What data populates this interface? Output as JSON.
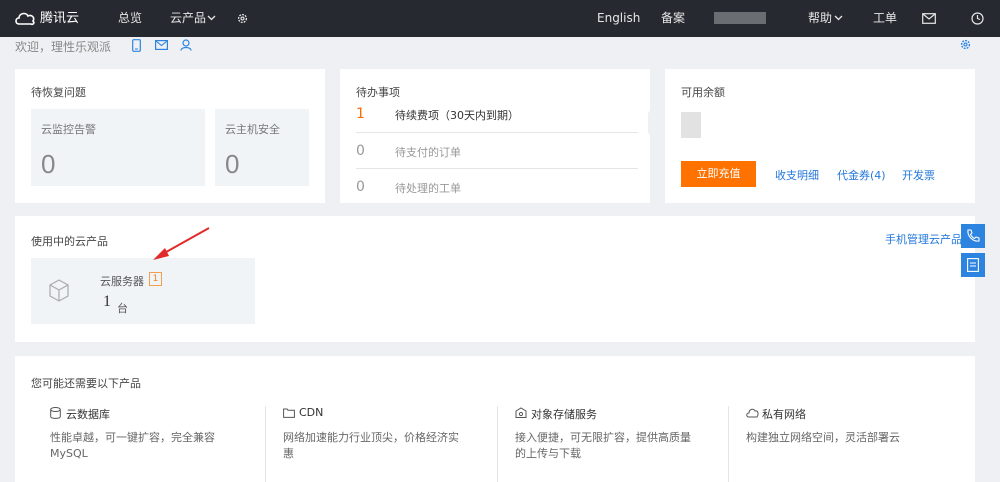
{
  "topbar": {
    "logo_text": "腾讯云",
    "nav_overview": "总览",
    "nav_products": "云产品",
    "lang": "English",
    "beian": "备案",
    "help": "帮助",
    "ticket": "工单"
  },
  "welcome": {
    "text": "欢迎，理性乐观派"
  },
  "recovery": {
    "title": "待恢复问题",
    "items": [
      {
        "label": "云监控告警",
        "value": "0"
      },
      {
        "label": "云主机安全",
        "value": "0"
      }
    ]
  },
  "todo": {
    "title": "待办事项",
    "items": [
      {
        "count": "1",
        "label": "待续费项（30天内到期）"
      },
      {
        "count": "0",
        "label": "待支付的订单"
      },
      {
        "count": "0",
        "label": "待处理的工单"
      }
    ]
  },
  "balance": {
    "title": "可用余额",
    "recharge_label": "立即充值",
    "links": [
      "收支明细",
      "代金券(4)",
      "开发票"
    ]
  },
  "inuse": {
    "title": "使用中的云产品",
    "mobile_link": "手机管理云产品",
    "product": {
      "name": "云服务器",
      "badge": "1",
      "count": "1",
      "unit": "台"
    }
  },
  "suggest": {
    "title": "您可能还需要以下产品",
    "items": [
      {
        "name": "云数据库",
        "desc": "性能卓越，可一键扩容，完全兼容MySQL"
      },
      {
        "name": "CDN",
        "desc": "网络加速能力行业顶尖，价格经济实惠"
      },
      {
        "name": "对象存储服务",
        "desc": "接入便捷，可无限扩容，提供高质量的上传与下载"
      },
      {
        "name": "私有网络",
        "desc": "构建独立网络空间，灵活部署云"
      }
    ]
  },
  "colors": {
    "topbar": "#262a30",
    "accent_orange": "#ff7200",
    "link_blue": "#2277da",
    "side_blue": "#2d84e0"
  }
}
